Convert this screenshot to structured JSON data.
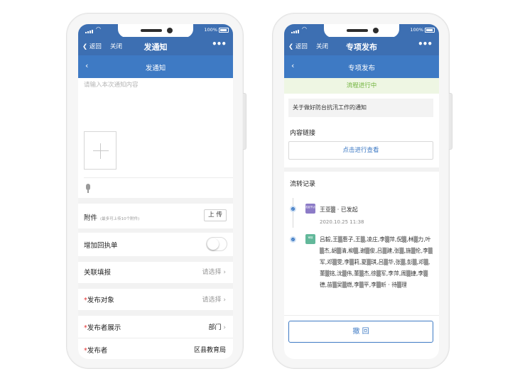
{
  "left": {
    "status": {
      "battery": "100%"
    },
    "nav": {
      "back": "返回",
      "close": "关闭",
      "title": "发通知"
    },
    "subheader": {
      "title": "发通知"
    },
    "content_placeholder": "请输入本次通知内容",
    "attachment": {
      "label": "附件",
      "hint": "(最多可上传10个附件)",
      "upload": "上 传"
    },
    "receipt": {
      "label": "增加回执单"
    },
    "fill": {
      "label": "关联填报",
      "value": "请选择"
    },
    "target": {
      "label": "发布对象",
      "value": "请选择"
    },
    "display": {
      "label": "发布者展示",
      "value": "部门"
    },
    "publisher": {
      "label": "发布者",
      "value": "区县教育局"
    }
  },
  "right": {
    "status": {
      "battery": "100%"
    },
    "nav": {
      "back": "返回",
      "close": "关闭",
      "title": "专项发布"
    },
    "subheader": {
      "title": "专项发布"
    },
    "banner": "流程进行中",
    "notice_title": "关于做好防台抗汛工作的通知",
    "content_link": {
      "label": "内容链接",
      "button": "点击进行查看"
    },
    "records": {
      "label": "流转记录",
      "items": [
        {
          "badge": "发起节点",
          "title": "王亚▒ · 已发起",
          "time": "2020.10.25 11:38"
        },
        {
          "badge": "审核",
          "names": "吕毅,王▒惠子,王▒,凌庄,李▒萍,倪▒,林▒力,叶▒杰,胡▒清,柳▒,谢▒俊,吕▒建,张▒,施▒伦,李▒军,邓▒雯,李▒莉,夏▒琪,吕▒华,张▒,彭▒,邓▒,董▒铭,沈▒伟,董▒杰,徐▒军,李萍,周▒捷,李▒德,苗▒吴▒燃,李▒平,李▒昕 · 待▒理"
        }
      ]
    },
    "recall": "撤 回"
  }
}
